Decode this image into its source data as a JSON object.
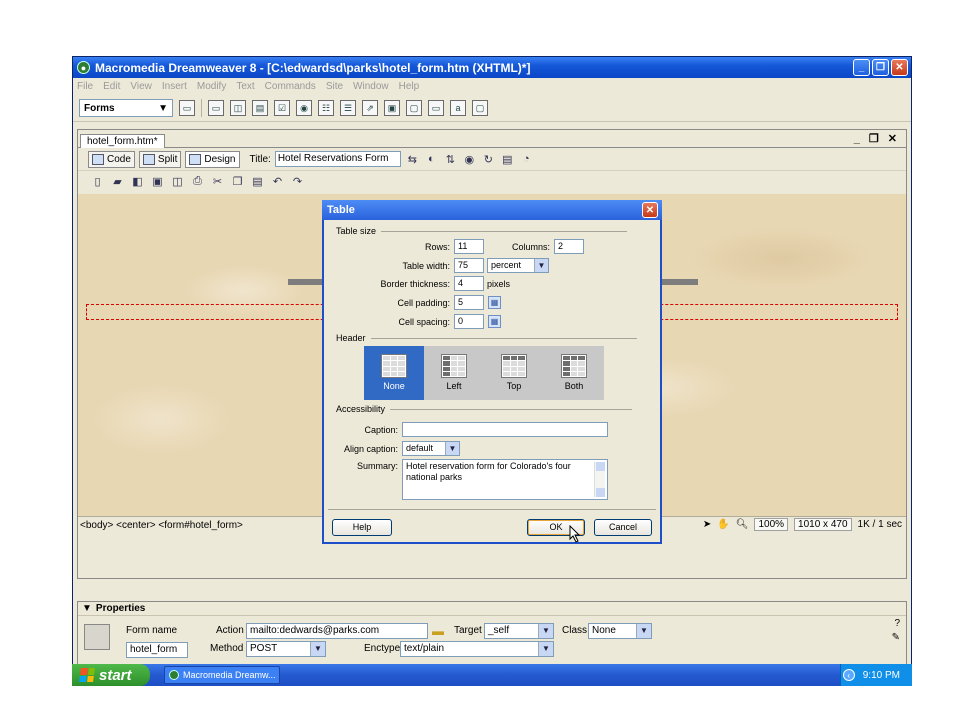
{
  "app": {
    "title": "Macromedia Dreamweaver 8 - [C:\\edwardsd\\parks\\hotel_form.htm (XHTML)*]",
    "menu": [
      "File",
      "Edit",
      "View",
      "Insert",
      "Modify",
      "Text",
      "Commands",
      "Site",
      "Window",
      "Help"
    ],
    "insert_category": "Forms"
  },
  "document": {
    "tab": "hotel_form.htm*",
    "view_code": "Code",
    "view_split": "Split",
    "view_design": "Design",
    "title_label": "Title:",
    "title_value": "Hotel Reservations Form",
    "status_path": "<body> <center> <form#hotel_form>",
    "zoom": "100%",
    "window_size": "1010 x 470",
    "download": "1K / 1 sec"
  },
  "dialog": {
    "title": "Table",
    "table_size_label": "Table size",
    "rows_label": "Rows:",
    "rows_value": "11",
    "columns_label": "Columns:",
    "columns_value": "2",
    "width_label": "Table width:",
    "width_value": "75",
    "width_unit": "percent",
    "border_label": "Border thickness:",
    "border_value": "4",
    "border_unit": "pixels",
    "padding_label": "Cell padding:",
    "padding_value": "5",
    "spacing_label": "Cell spacing:",
    "spacing_value": "0",
    "header_label": "Header",
    "header_options": [
      "None",
      "Left",
      "Top",
      "Both"
    ],
    "header_selected": "None",
    "accessibility_label": "Accessibility",
    "caption_label": "Caption:",
    "caption_value": "",
    "align_caption_label": "Align caption:",
    "align_caption_value": "default",
    "summary_label": "Summary:",
    "summary_value": "Hotel reservation form for Colorado's four national parks",
    "help_button": "Help",
    "ok_button": "OK",
    "cancel_button": "Cancel"
  },
  "properties": {
    "header": "Properties",
    "form_name_label": "Form name",
    "form_name_value": "hotel_form",
    "action_label": "Action",
    "action_value": "mailto:dedwards@parks.com",
    "target_label": "Target",
    "target_value": "_self",
    "class_label": "Class",
    "class_value": "None",
    "method_label": "Method",
    "method_value": "POST",
    "enctype_label": "Enctype",
    "enctype_value": "text/plain"
  },
  "taskbar": {
    "start": "start",
    "task": "Macromedia Dreamw...",
    "clock": "9:10 PM"
  }
}
